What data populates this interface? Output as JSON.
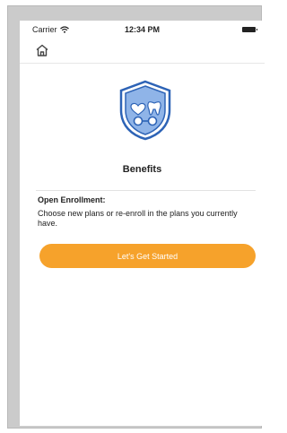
{
  "status_bar": {
    "carrier": "Carrier",
    "time": "12:34 PM"
  },
  "icons": {
    "home": "home-icon",
    "wifi": "wifi-icon",
    "battery": "battery-icon",
    "benefits": "shield-benefits-icon"
  },
  "colors": {
    "accent": "#F6A22B",
    "shield_fill": "#8FB4E8",
    "shield_stroke": "#2D63B6"
  },
  "main": {
    "title": "Benefits",
    "enrollment_heading": "Open Enrollment:",
    "enrollment_description": "Choose new plans or re-enroll in the plans you currently have.",
    "start_button_label": "Let's Get Started"
  }
}
